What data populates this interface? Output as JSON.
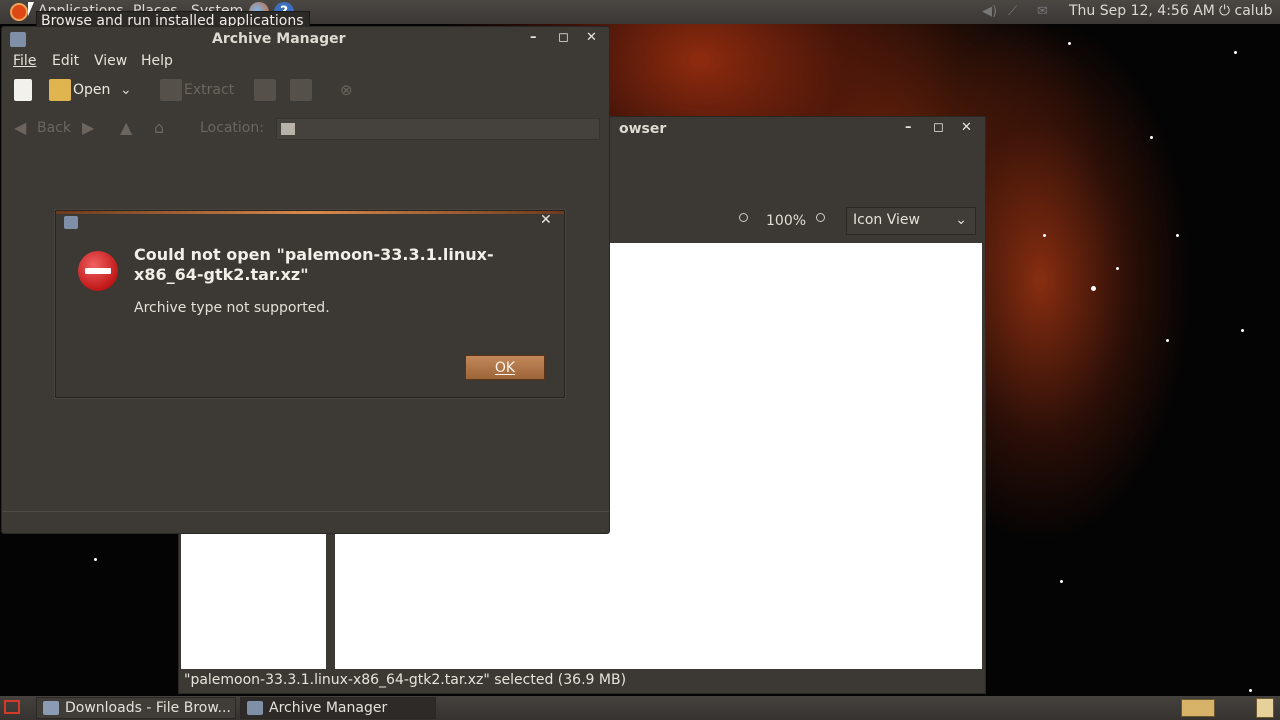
{
  "top_panel": {
    "menus": [
      "Applications",
      "Places",
      "System"
    ],
    "tooltip": "Browse and run installed applications",
    "clock": "Thu Sep 12,  4:56 AM",
    "user": "calub"
  },
  "file_browser": {
    "title": "owser",
    "zoom_level": "100%",
    "view_mode": "Icon View",
    "status": "\"palemoon-33.3.1.linux-x86_64-gtk2.tar.xz\" selected (36.9 MB)"
  },
  "archive_manager": {
    "title": "Archive Manager",
    "menu": [
      "File",
      "Edit",
      "View",
      "Help"
    ],
    "toolbar": {
      "open_label": "Open",
      "extract_label": "Extract"
    },
    "nav": {
      "back_label": "Back",
      "location_label": "Location:"
    }
  },
  "dialog": {
    "heading": "Could not open \"palemoon-33.3.1.linux-x86_64-gtk2.tar.xz\"",
    "message": "Archive type not supported.",
    "ok_label": "OK"
  },
  "taskbar": {
    "tasks": [
      "Downloads - File Brow...",
      "Archive Manager"
    ]
  },
  "icons": {
    "error": "error-stop-icon",
    "ubuntu": "ubuntu-logo-icon",
    "firefox": "firefox-icon",
    "help": "help-icon"
  },
  "colors": {
    "accent": "#c2885a",
    "panel": "#3a3734",
    "error": "#c01818"
  }
}
